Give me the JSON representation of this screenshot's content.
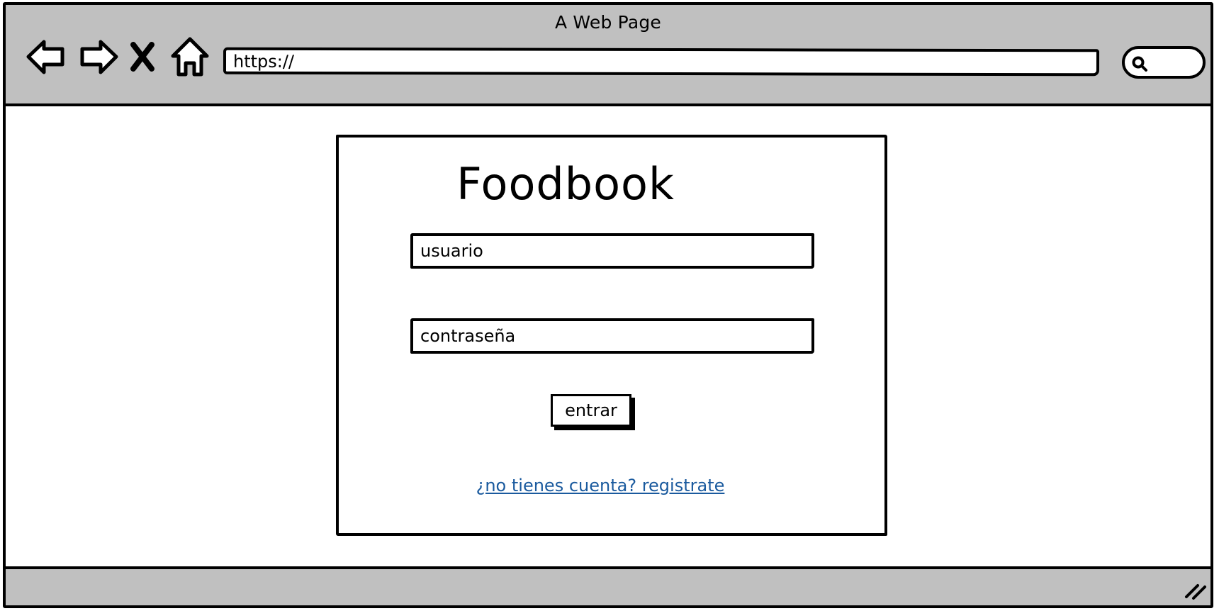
{
  "browser": {
    "title": "A Web Page",
    "url": "https://",
    "nav": [
      "back-icon",
      "forward-icon",
      "close-icon",
      "home-icon"
    ],
    "search_icon": "search-icon",
    "resize_icon": "resize-grip-icon"
  },
  "login": {
    "app_title": "Foodbook",
    "username_placeholder": "usuario",
    "password_placeholder": "contraseña",
    "submit_label": "entrar",
    "register_link": "¿no tienes cuenta? registrate"
  },
  "colors": {
    "chrome": "#c0c0c0",
    "link": "#1a5a9e"
  }
}
